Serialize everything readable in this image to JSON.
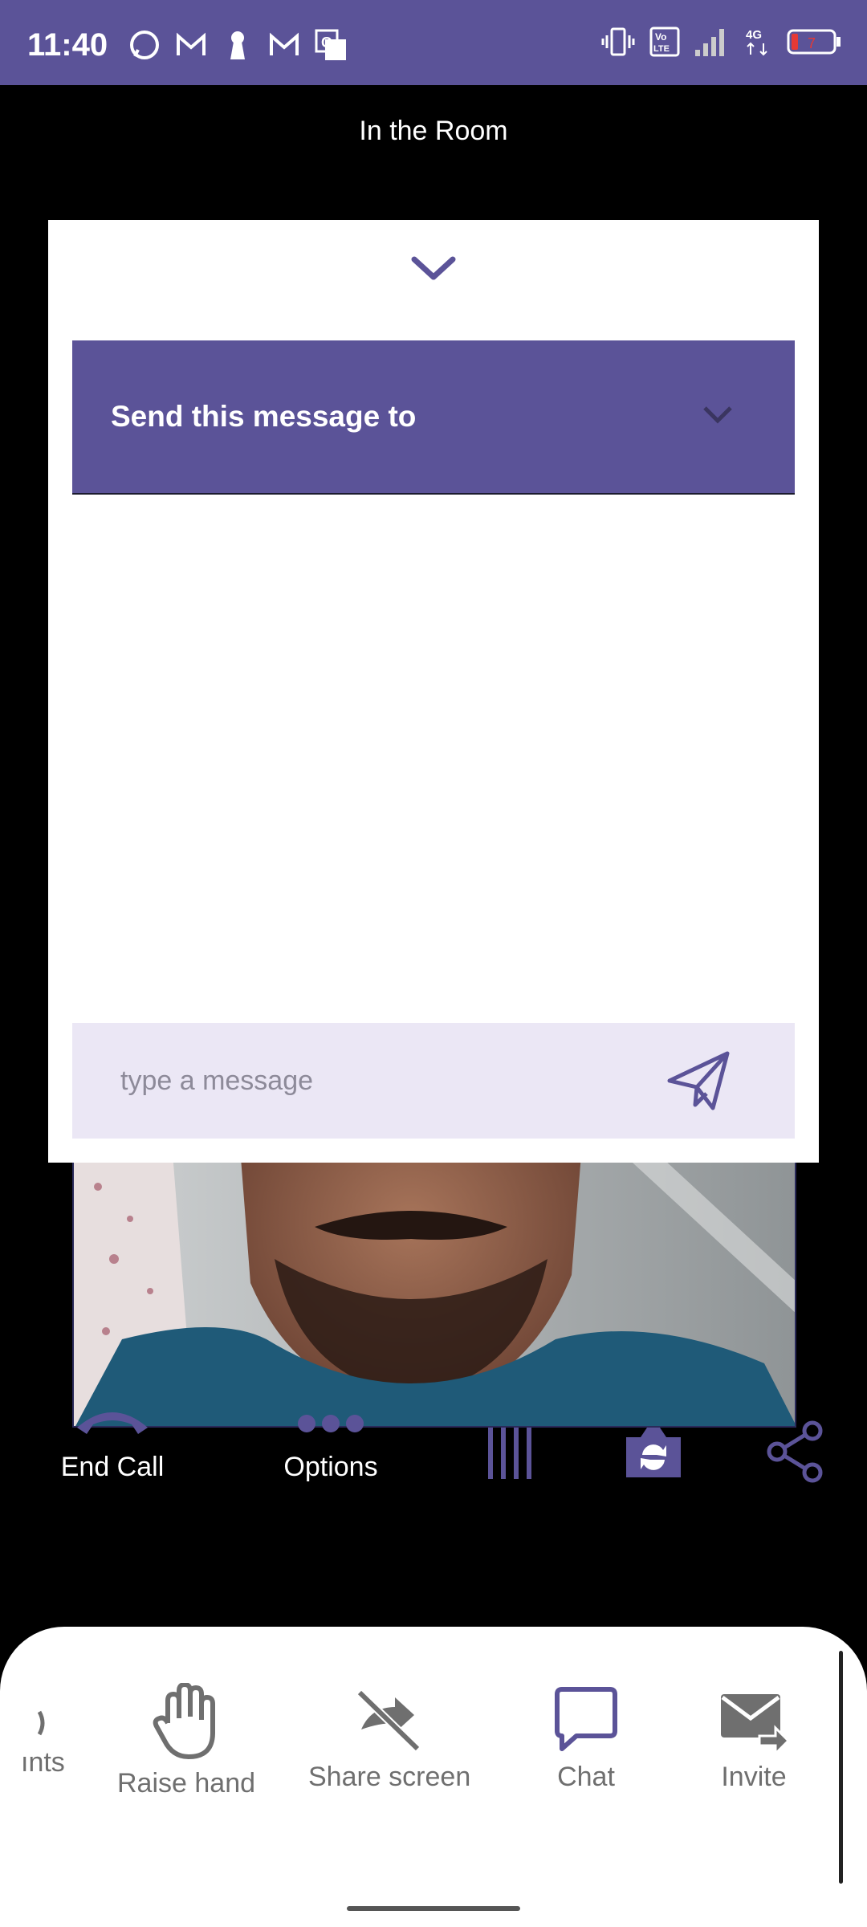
{
  "status_bar": {
    "time": "11:40",
    "left_icons": [
      "whatsapp-icon",
      "gmail-icon",
      "keyhole-icon",
      "gmail-icon",
      "translate-icon"
    ],
    "right_icons": [
      "vibrate-icon",
      "volte-icon",
      "signal-icon",
      "4g-icon",
      "battery-icon"
    ],
    "battery_level": "7"
  },
  "room": {
    "title": "In the Room"
  },
  "chat_sheet": {
    "recipient_label": "Send this message to",
    "message_placeholder": "type a message"
  },
  "controls": {
    "end_call": "End Call",
    "options": "Options"
  },
  "toolbar": {
    "participants_partial": "ınts",
    "raise_hand": "Raise hand",
    "share_screen": "Share screen",
    "chat": "Chat",
    "invite": "Invite"
  },
  "colors": {
    "accent": "#5b5398",
    "compose_bg": "#ebe7f5",
    "tool_gray": "#6f6f6f"
  }
}
